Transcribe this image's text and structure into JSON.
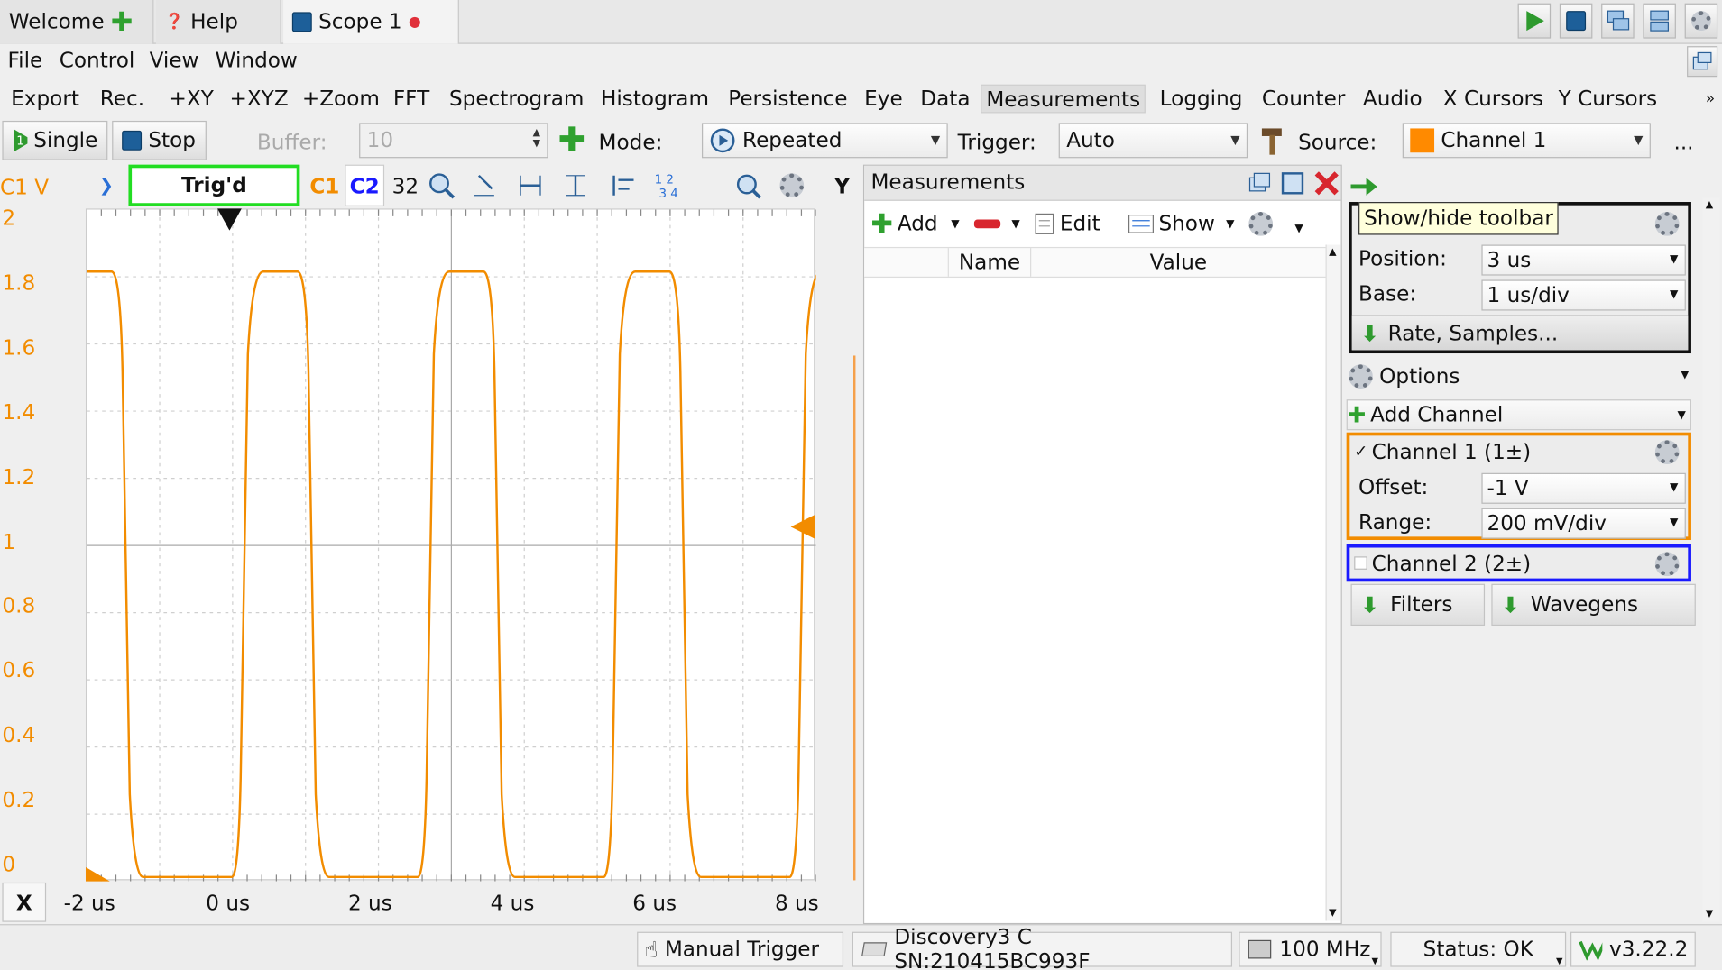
{
  "tabs": {
    "welcome": "Welcome",
    "help": "Help",
    "scope": "Scope 1"
  },
  "menu": {
    "file": "File",
    "control": "Control",
    "view": "View",
    "window": "Window"
  },
  "instruments": [
    "Export",
    "Rec.",
    "+XY",
    "+XYZ",
    "+Zoom",
    "FFT",
    "Spectrogram",
    "Histogram",
    "Persistence",
    "Eye",
    "Data",
    "Measurements",
    "Logging",
    "Counter",
    "Audio",
    "X Cursors",
    "Y Cursors"
  ],
  "controls": {
    "single": "Single",
    "stop": "Stop",
    "buffer_label": "Buffer:",
    "buffer_value": "10",
    "mode_label": "Mode:",
    "mode_value": "Repeated",
    "trigger_label": "Trigger:",
    "trigger_value": "Auto",
    "source_label": "Source:",
    "source_value": "Channel 1",
    "more": "..."
  },
  "scope": {
    "y_unit": "C1 V",
    "trig_status": "Trig'd",
    "c1": "C1",
    "c2": "C2",
    "bits": "32",
    "y_axis_btn": "Y",
    "x_axis_btn": "X",
    "y_ticks": [
      "2",
      "1.8",
      "1.6",
      "1.4",
      "1.2",
      "1",
      "0.8",
      "0.6",
      "0.4",
      "0.2",
      "0"
    ],
    "x_ticks": [
      "-2 us",
      "0 us",
      "2 us",
      "4 us",
      "6 us",
      "8 us"
    ],
    "trace_color": "#f28c00"
  },
  "measurements": {
    "title": "Measurements",
    "add": "Add",
    "edit": "Edit",
    "show": "Show",
    "col_name": "Name",
    "col_value": "Value"
  },
  "timebase": {
    "tooltip": "Show/hide toolbar",
    "position_label": "Position:",
    "position_value": "3 us",
    "base_label": "Base:",
    "base_value": "1 us/div",
    "rate_samples": "Rate, Samples..."
  },
  "options": {
    "label": "Options",
    "add_channel": "Add Channel"
  },
  "channel1": {
    "title": "Channel 1 (1±)",
    "offset_label": "Offset:",
    "offset_value": "-1 V",
    "range_label": "Range:",
    "range_value": "200 mV/div",
    "color": "#f28c00"
  },
  "channel2": {
    "title": "Channel 2 (2±)",
    "color": "#1a1aff"
  },
  "bottom_buttons": {
    "filters": "Filters",
    "wavegens": "Wavegens"
  },
  "status": {
    "manual_trigger": "Manual Trigger",
    "device": "Discovery3 C SN:210415BC993F",
    "freq": "100 MHz",
    "status": "Status: OK",
    "version": "v3.22.2"
  }
}
